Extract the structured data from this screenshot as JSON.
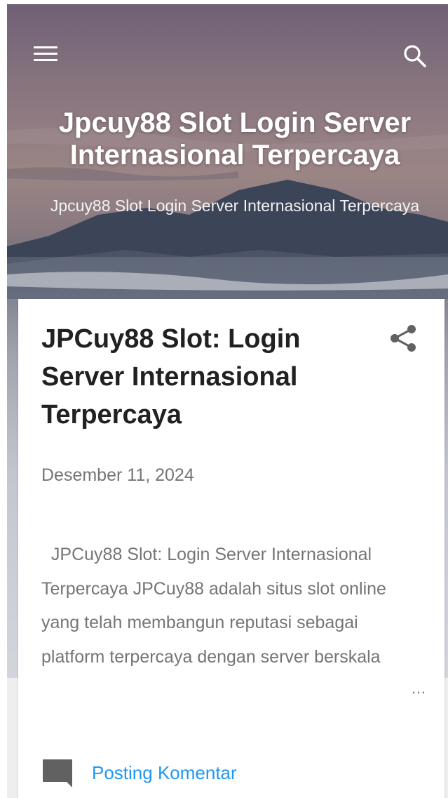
{
  "header": {
    "blog_title": "Jpcuy88 Slot Login Server Internasional Terpercaya",
    "blog_description": "Jpcuy88 Slot Login Server Internasional Terpercaya",
    "menu_icon": "hamburger-menu-icon",
    "search_icon": "search-icon"
  },
  "post": {
    "title": "JPCuy88 Slot: Login Server Internasional Terpercaya",
    "date": "Desember 11, 2024",
    "snippet": "JPCuy88 Slot: Login Server Internasional Terpercaya JPCuy88 adalah situs slot online yang telah membangun reputasi sebagai platform terpercaya dengan server berskala",
    "ellipsis": "…",
    "share_icon": "share-icon",
    "comment_icon": "comment-icon",
    "comment_label": "Posting Komentar"
  },
  "colors": {
    "title_text": "#212121",
    "meta_text": "#757575",
    "link": "#2196f3",
    "header_text": "#ffffff",
    "page_background": "#eeeeee"
  }
}
